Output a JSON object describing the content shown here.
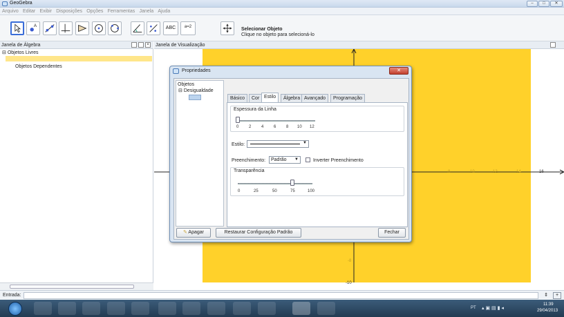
{
  "window": {
    "title": "GeoGebra"
  },
  "menu": [
    "Arquivo",
    "Editar",
    "Exibir",
    "Disposições",
    "Opções",
    "Ferramentas",
    "Janela",
    "Ajuda"
  ],
  "toolbar": {
    "tip_title": "Selecionar Objeto",
    "tip_sub": "Clique no objeto para selecioná-lo",
    "text_tool": "ABC",
    "slider_tool": "a=2"
  },
  "algebra": {
    "title": "Janela de Álgebra",
    "free": "Objetos Livres",
    "dependent": "Objetos Dependentes"
  },
  "graphics": {
    "title": "Janela de Visualização",
    "x_ticks": [
      "6",
      "8",
      "10",
      "12",
      "14",
      "16"
    ],
    "y_ticks": [
      "-8",
      "-10"
    ],
    "shade_color": "#ffd12a"
  },
  "dialog": {
    "title": "Propriedades",
    "tree": {
      "root": "Objetos",
      "child": "Desigualdade"
    },
    "tabs": [
      "Básico",
      "Cor",
      "Estilo",
      "Álgebra",
      "Avançado",
      "Programação"
    ],
    "active_tab": "Estilo",
    "line_thickness": {
      "label": "Espessura da Linha",
      "ticks": [
        "0",
        "2",
        "4",
        "6",
        "8",
        "10",
        "12"
      ],
      "value": 0
    },
    "style_label": "Estilo:",
    "fill_label": "Preenchimento:",
    "fill_value": "Padrão",
    "invert_label": "Inverter Preenchimento",
    "transparency": {
      "label": "Transparência",
      "ticks": [
        "0",
        "25",
        "50",
        "75",
        "100"
      ],
      "value": 75
    },
    "buttons": {
      "delete": "Apagar",
      "restore": "Restaurar Configuração Padrão",
      "close": "Fechar"
    }
  },
  "input": {
    "label": "Entrada:"
  },
  "taskbar": {
    "lang": "PT",
    "time": "11:39",
    "date": "29/04/2013"
  }
}
